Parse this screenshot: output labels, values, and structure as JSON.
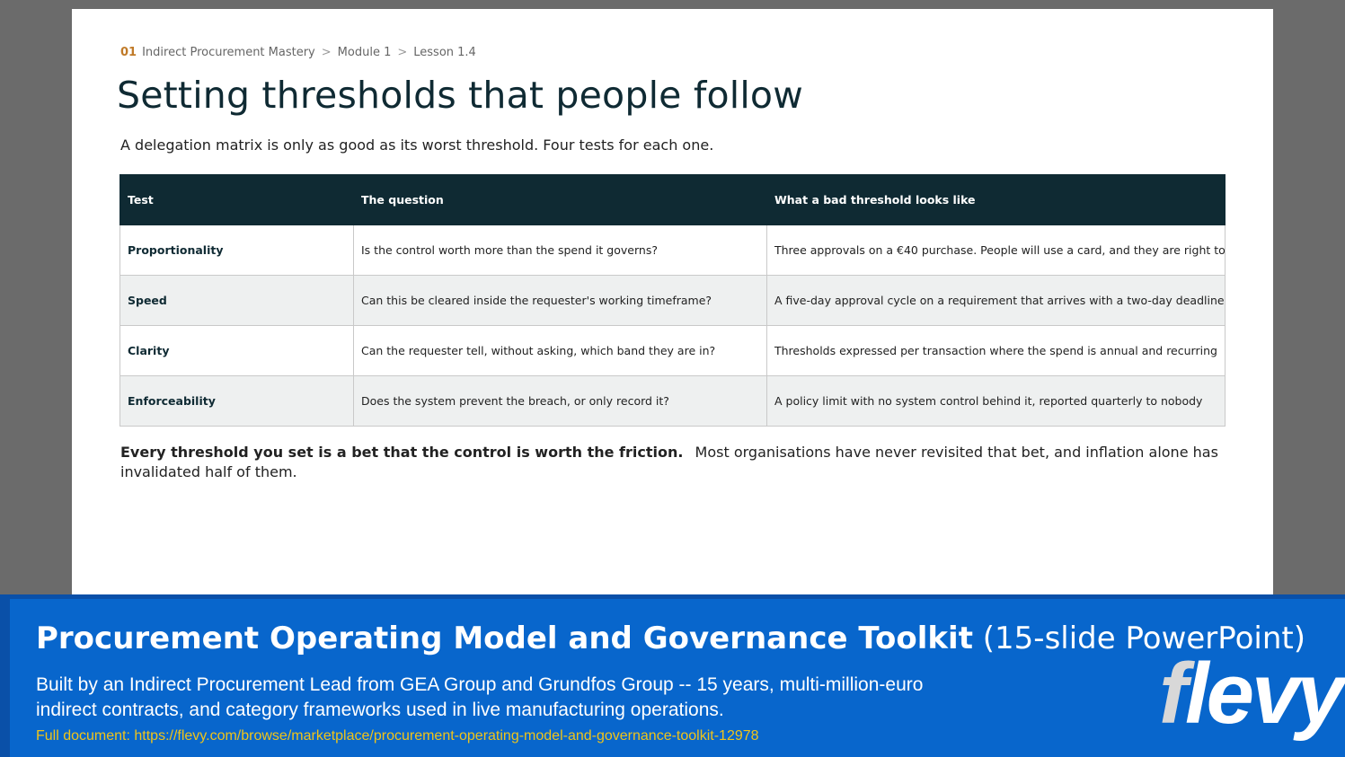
{
  "breadcrumb": {
    "number": "01",
    "course": "Indirect Procurement Mastery",
    "module": "Module 1",
    "lesson": "Lesson 1.4",
    "separator": ">"
  },
  "slide": {
    "title": "Setting thresholds that people follow",
    "subtitle": "A delegation matrix is only as good as its worst threshold. Four tests for each one."
  },
  "table": {
    "headers": [
      "Test",
      "The question",
      "What a bad threshold looks like"
    ],
    "rows": [
      [
        "Proportionality",
        "Is the control worth more than the spend it governs?",
        "Three approvals on a €40 purchase. People will use a card, and they are right to"
      ],
      [
        "Speed",
        "Can this be cleared inside the requester's working timeframe?",
        "A five-day approval cycle on a requirement that arrives with a two-day deadline"
      ],
      [
        "Clarity",
        "Can the requester tell, without asking, which band they are in?",
        "Thresholds expressed per transaction where the spend is annual and recurring"
      ],
      [
        "Enforceability",
        "Does the system prevent the breach, or only record it?",
        "A policy limit with no system control behind it, reported quarterly to nobody"
      ]
    ]
  },
  "closing": {
    "bold": "Every threshold you set is a bet that the control is worth the friction.",
    "text": "Most organisations have never revisited that bet, and inflation alone has invalidated half of them."
  },
  "banner": {
    "title": "Procurement Operating Model and Governance Toolkit",
    "title_suffix": "(15-slide PowerPoint)",
    "description": "Built by an Indirect Procurement Lead from GEA Group and Grundfos Group -- 15 years, multi-million-euro indirect contracts, and category frameworks used in live manufacturing operations.",
    "link": "Full document: https://flevy.com/browse/marketplace/procurement-operating-model-and-governance-toolkit-12978",
    "logo_first": "f",
    "logo_rest": "levy"
  },
  "colors": {
    "header_bg": "#0f2a33",
    "accent_orange": "#c07a28",
    "banner_blue": "#0866cc",
    "link_yellow": "#f0c419"
  }
}
